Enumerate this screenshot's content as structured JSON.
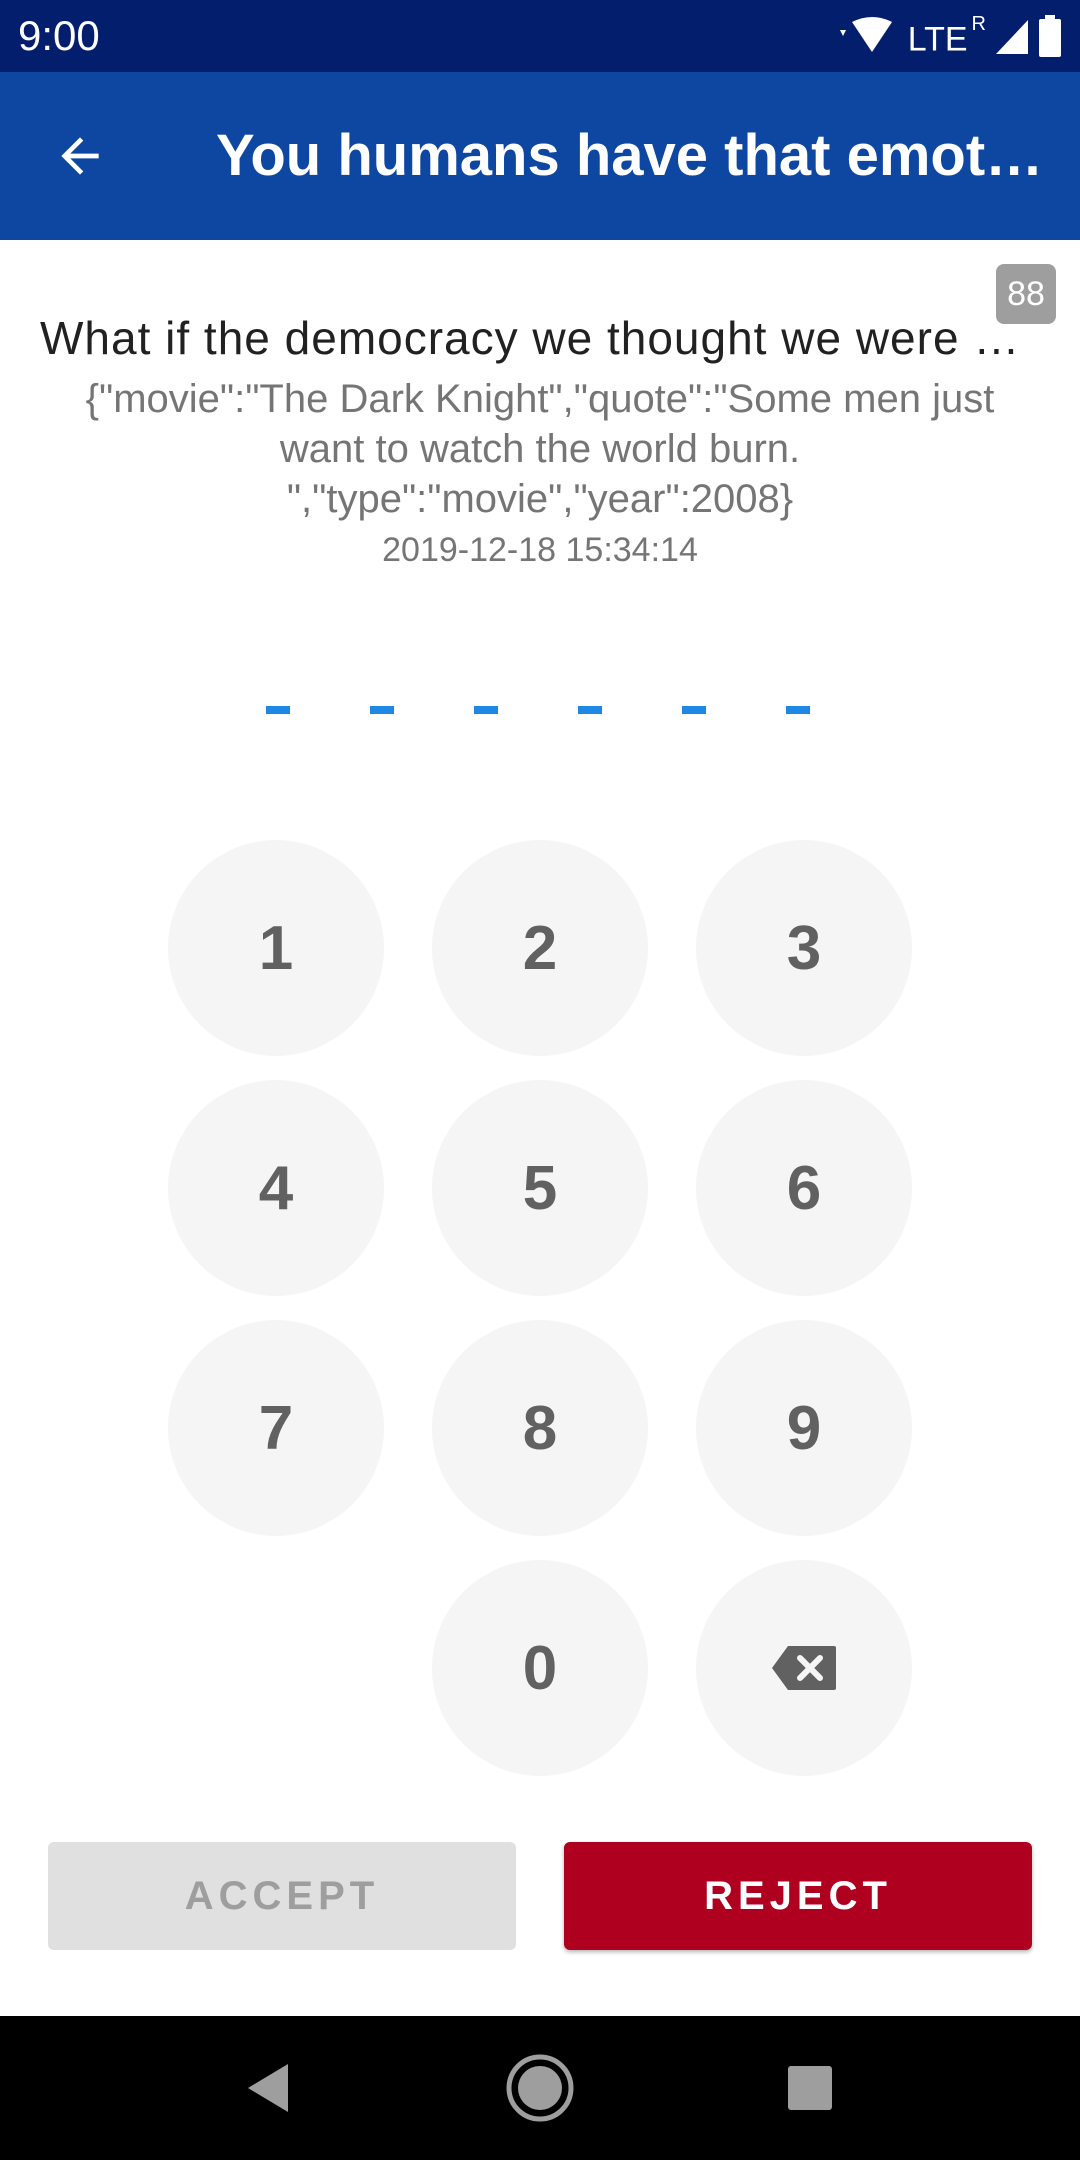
{
  "status_bar": {
    "time": "9:00",
    "network": "LTE",
    "roaming": "R"
  },
  "app_bar": {
    "title": "You humans have that emotion..."
  },
  "counter": "88",
  "request": {
    "title": "What if the democracy we thought we were serving...",
    "payload": "{\"movie\":\"The Dark Knight\",\"quote\":\"Some men just want to watch the world burn. \",\"type\":\"movie\",\"year\":2008}",
    "timestamp": "2019-12-18 15:34:14"
  },
  "pin": {
    "length": 6,
    "dash_color": "#1e88e5"
  },
  "keypad": {
    "keys": [
      "1",
      "2",
      "3",
      "4",
      "5",
      "6",
      "7",
      "8",
      "9",
      "0"
    ],
    "backspace_icon": "backspace-icon"
  },
  "actions": {
    "accept_label": "ACCEPT",
    "reject_label": "REJECT"
  },
  "colors": {
    "status_bar": "#041e6e",
    "app_bar": "#0d47a1",
    "reject": "#b00020",
    "accept_disabled": "#e0e0e0"
  },
  "icons": {
    "back": "arrow-back-icon",
    "wifi": "wifi-icon",
    "signal": "signal-icon",
    "battery": "battery-icon",
    "nav_back": "nav-back-icon",
    "nav_home": "nav-home-icon",
    "nav_recents": "nav-recents-icon"
  }
}
